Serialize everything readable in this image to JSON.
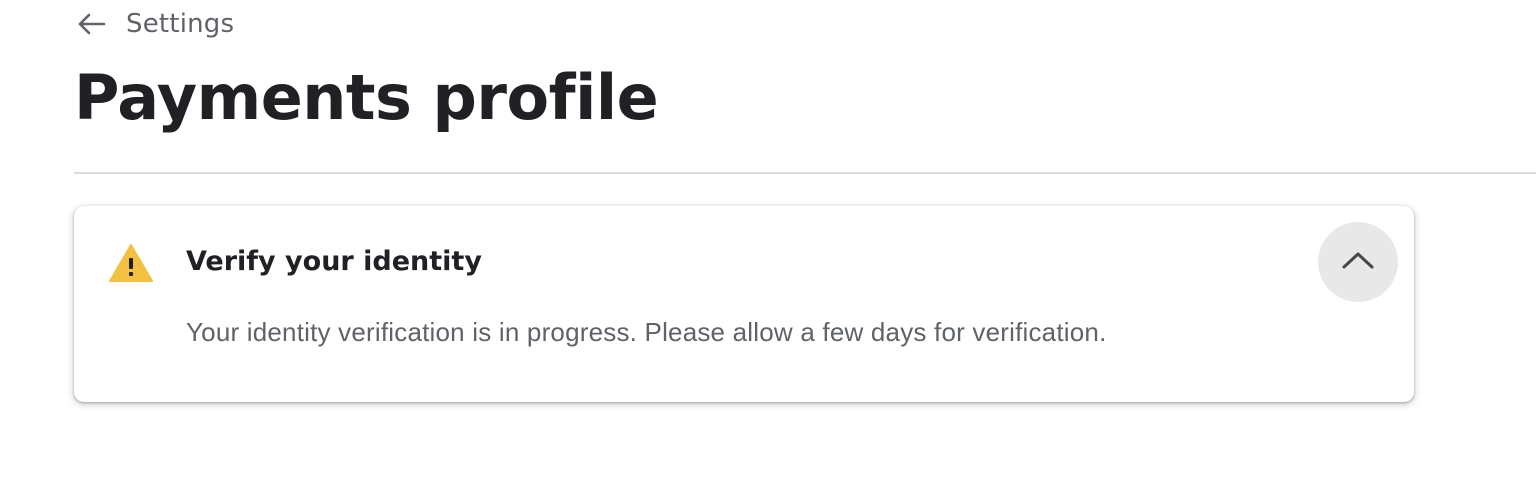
{
  "header": {
    "back_label": "Settings",
    "back_icon": "arrow-back-icon",
    "title": "Payments profile"
  },
  "alert": {
    "icon": "warning-triangle-icon",
    "title": "Verify your identity",
    "message": "Your identity verification is in progress. Please allow a few days for verification.",
    "collapse_icon": "chevron-up-icon",
    "expanded": true,
    "colors": {
      "warning": "#F4C041",
      "text_primary": "#202124",
      "text_secondary": "#5F6368",
      "button_bg": "#E8E8E8"
    }
  }
}
